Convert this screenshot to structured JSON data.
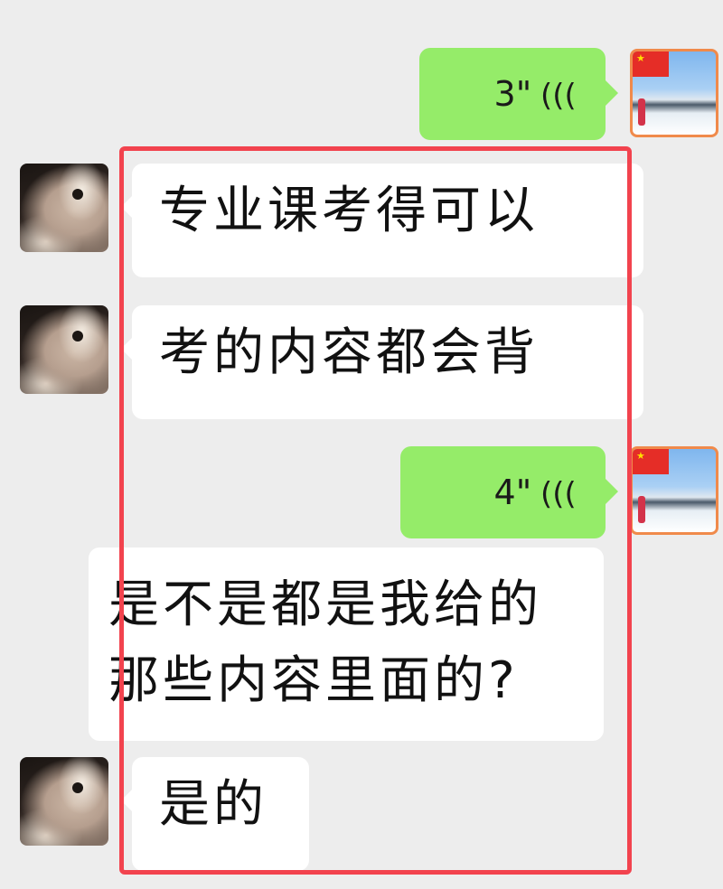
{
  "messages": [
    {
      "sender": "me",
      "type": "voice",
      "duration": "3\"",
      "icon": "voice-wave-icon"
    },
    {
      "sender": "other",
      "type": "text",
      "text": "专业课考得可以"
    },
    {
      "sender": "other",
      "type": "text",
      "text": "考的内容都会背"
    },
    {
      "sender": "me",
      "type": "voice",
      "duration": "4\"",
      "icon": "voice-wave-icon"
    },
    {
      "sender": "other",
      "type": "text",
      "lines": [
        "是不是都是我给的",
        "那些内容里面的?"
      ]
    },
    {
      "sender": "other",
      "type": "text",
      "text": "是的"
    }
  ],
  "colors": {
    "background": "#ededed",
    "my_bubble": "#95ec69",
    "other_bubble": "#ffffff",
    "highlight_border": "#f2434e"
  }
}
